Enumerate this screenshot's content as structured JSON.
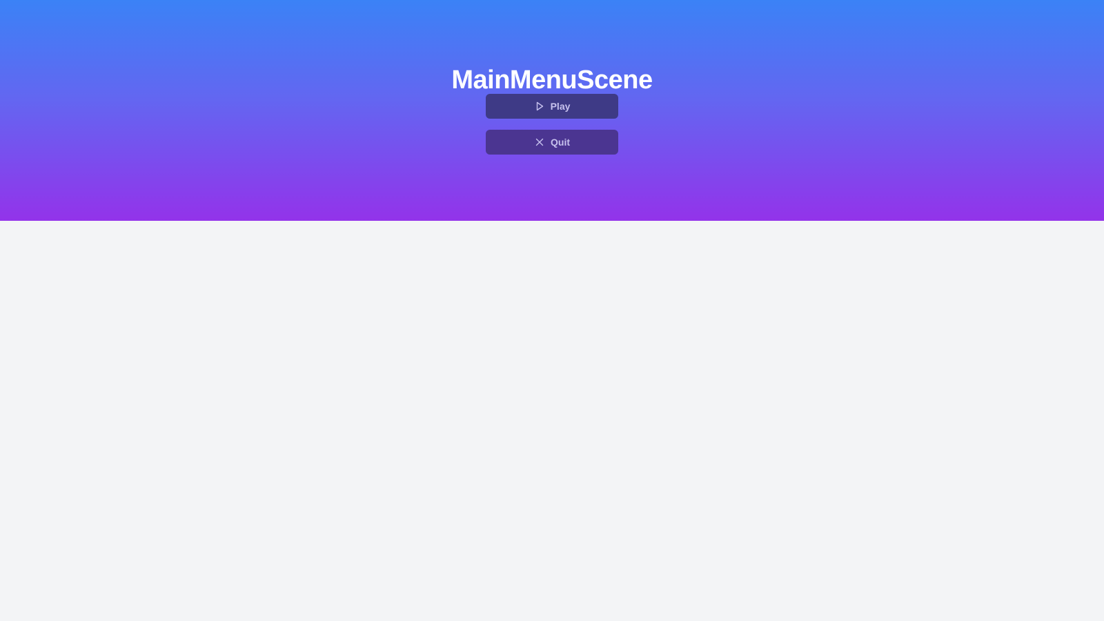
{
  "scene": {
    "title": "MainMenuScene"
  },
  "menu": {
    "buttons": [
      {
        "label": "Play",
        "icon": "play-icon"
      },
      {
        "label": "Quit",
        "icon": "close-icon"
      }
    ]
  },
  "colors": {
    "gradient_top": "#3b82f6",
    "gradient_bottom": "#9333ea",
    "page_background": "#f3f4f6",
    "button_play_bg": "#3e3a86",
    "button_quit_bg": "#4b3591",
    "button_text": "#c7c2ee"
  }
}
